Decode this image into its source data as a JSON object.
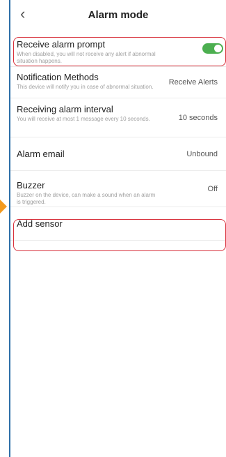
{
  "header": {
    "title": "Alarm mode",
    "back_icon": "chevron-left-icon"
  },
  "settings": [
    {
      "label": "Receive alarm prompt",
      "description": "When disabled, you will not receive any alert if abnormal situation happens.",
      "toggle_on": true
    },
    {
      "label": "Notification Methods",
      "description": "This device will notify you in case of abnormal situation.",
      "value": "Receive Alerts"
    },
    {
      "label": "Receiving alarm interval",
      "description": "You will receive at most 1 message every 10 seconds.",
      "value": "10 seconds"
    },
    {
      "label": "Alarm email",
      "value": "Unbound"
    },
    {
      "label": "Buzzer",
      "description": "Buzzer on the device, can make a sound when an alarm is triggered.",
      "value": "Off"
    },
    {
      "label": "Add sensor"
    }
  ],
  "colors": {
    "toggle_on": "#4caf50",
    "highlight": "#d8313c",
    "frame": "#2d6fa8",
    "pointer": "#f39a1e"
  }
}
